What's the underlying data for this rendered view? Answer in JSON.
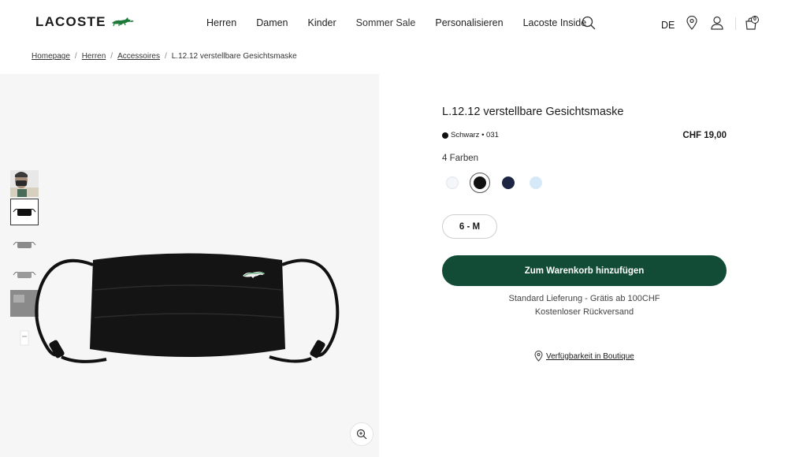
{
  "header": {
    "brand": "LACOSTE",
    "nav": [
      "Herren",
      "Damen",
      "Kinder",
      "Sommer Sale",
      "Personalisieren",
      "Lacoste Inside"
    ],
    "language": "DE",
    "cart_count": "0",
    "icons": [
      "search-icon",
      "location-pin-icon",
      "user-icon",
      "cart-icon"
    ]
  },
  "breadcrumb": {
    "items": [
      "Homepage",
      "Herren",
      "Accessoires"
    ],
    "current": "L.12.12 verstellbare Gesichtsmaske",
    "separator": "/"
  },
  "gallery": {
    "thumbnails": [
      "model-wearing-mask",
      "black-mask-front",
      "grey-mask",
      "grey-mask-alt",
      "grey-mask-packaging",
      "packaging"
    ],
    "active_index": 1
  },
  "product": {
    "title": "L.12.12 verstellbare Gesichtsmaske",
    "color_name": "Schwarz • 031",
    "price": "CHF 19,00",
    "colors_count": "4 Farben",
    "swatches": [
      {
        "name": "white",
        "color": "#f4f6f9"
      },
      {
        "name": "black",
        "color": "#111111",
        "selected": true
      },
      {
        "name": "navy",
        "color": "#1c2541"
      },
      {
        "name": "light-blue",
        "color": "#d6e9f8"
      }
    ],
    "size": "6 - M",
    "add_to_cart": "Zum Warenkorb hinzufügen",
    "delivery_line1": "Standard Lieferung - Grätis ab 100CHF",
    "delivery_line2": "Kostenloser Rückversand",
    "boutique_link": "Verfügbarkeit in Boutique"
  },
  "colors": {
    "accent_green": "#124b36",
    "gallery_bg": "#f6f6f6"
  }
}
